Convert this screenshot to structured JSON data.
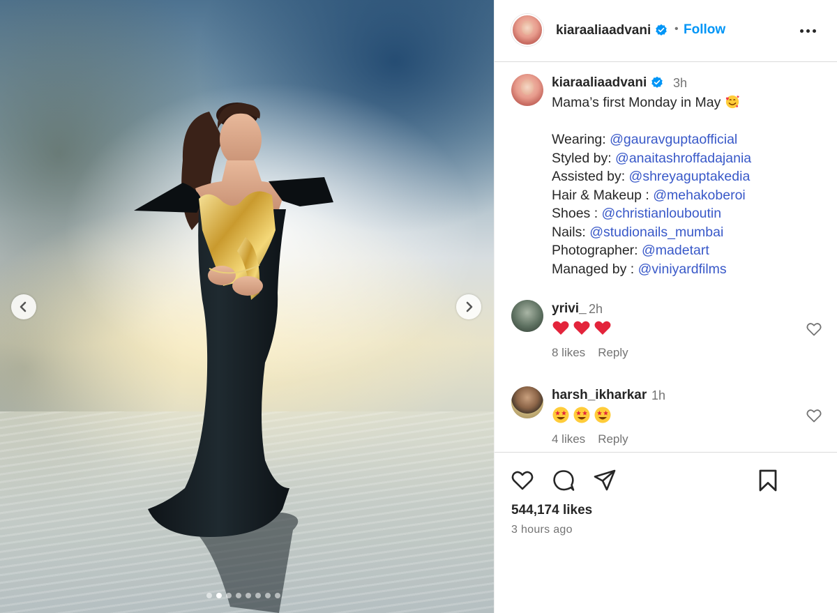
{
  "post": {
    "username": "kiaraaliaadvani",
    "verified": true,
    "follow_label": "Follow",
    "separator": "•",
    "more_icon": "more-horizontal-icon",
    "carousel": {
      "total_slides": 8,
      "active_index": 1
    }
  },
  "caption": {
    "username": "kiaraaliaadvani",
    "time": "3h",
    "first_line": "Mama’s first Monday in May",
    "first_line_emoji": "smiling-face-with-hearts",
    "credits": [
      {
        "label": "Wearing: ",
        "handle": "@gauravguptaofficial"
      },
      {
        "label": "Styled by: ",
        "handle": "@anaitashroffadajania"
      },
      {
        "label": "Assisted by: ",
        "handle": "@shreyaguptakedia"
      },
      {
        "label": "Hair & Makeup : ",
        "handle": "@mehakoberoi"
      },
      {
        "label": "Shoes : ",
        "handle": "@christianlouboutin"
      },
      {
        "label": "Nails: ",
        "handle": "@studionails_mumbai"
      },
      {
        "label": "Photographer: ",
        "handle": "@madetart"
      },
      {
        "label": "Managed by : ",
        "handle": "@viniyardfilms"
      }
    ]
  },
  "comments": [
    {
      "username": "yrivi_",
      "time": "2h",
      "emojis": [
        "red-heart",
        "red-heart",
        "red-heart"
      ],
      "likes": "8 likes",
      "reply": "Reply"
    },
    {
      "username": "harsh_ikharkar",
      "time": "1h",
      "emojis": [
        "star-struck",
        "star-struck",
        "star-struck"
      ],
      "likes": "4 likes",
      "reply": "Reply"
    }
  ],
  "footer": {
    "likes": "544,174 likes",
    "time_ago": "3 hours ago"
  },
  "colors": {
    "link": "#3858c8",
    "follow": "#0095f6",
    "verified": "#0095f6",
    "heart": "#e0245e",
    "muted": "#737373"
  }
}
